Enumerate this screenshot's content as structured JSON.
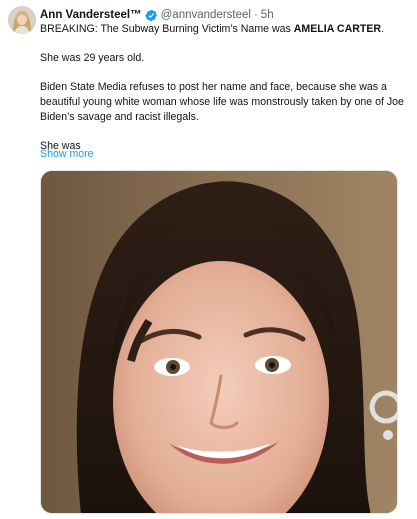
{
  "tweet": {
    "author_name": "Ann Vandersteel™",
    "verified_icon": "verified-badge-icon",
    "handle": "@annvandersteel",
    "separator": "·",
    "timestamp": "5h",
    "text": {
      "line1_prefix": "BREAKING: The Subway Burning Victim’s Name was ",
      "line1_name": "AMELIA CARTER",
      "line1_suffix": ".",
      "para2": "She was 29 years old.",
      "para3": "Biden State Media refuses to post her name and face, because she was a beautiful young white woman whose life was monstrously taken by one of Joe Biden’s savage and racist illegals.",
      "para4": "She was"
    },
    "show_more_label": "Show more",
    "colors": {
      "link": "#1d9bf0",
      "verified": "#1d9bf0",
      "secondary_text": "#536471"
    }
  }
}
